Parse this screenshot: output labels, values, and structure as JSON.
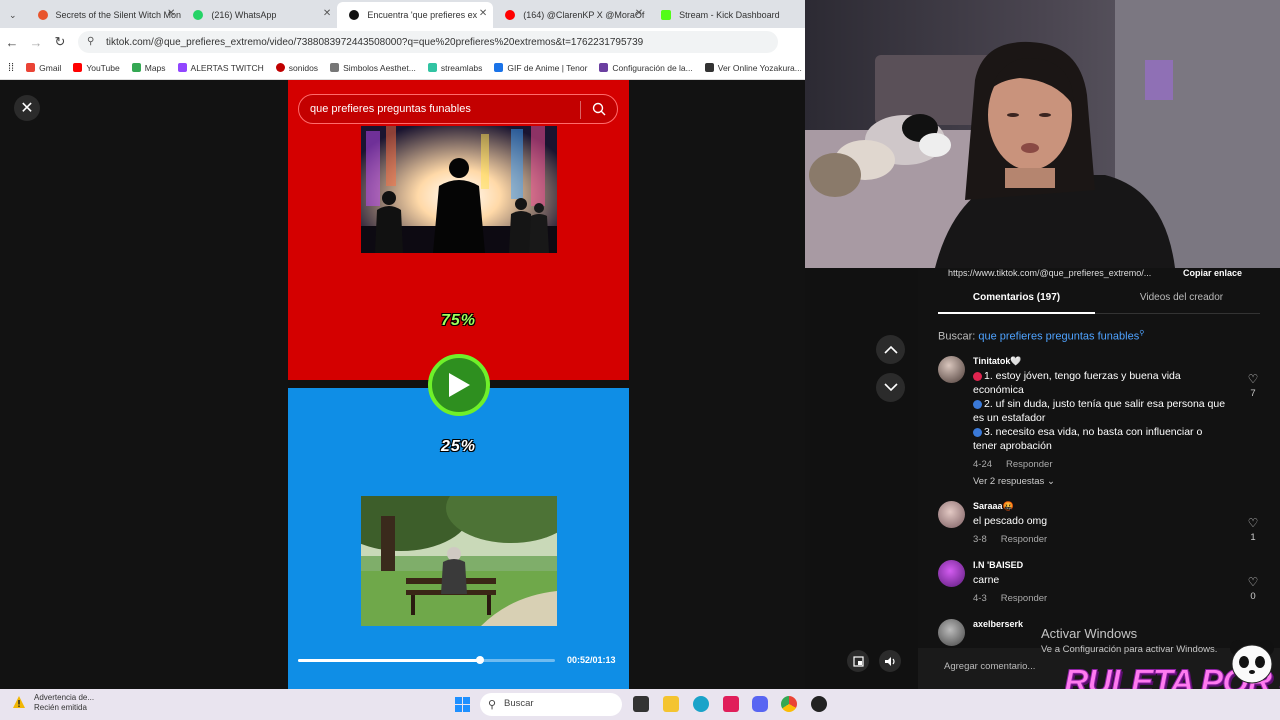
{
  "browser": {
    "tabs": [
      {
        "label": "Secrets of the Silent Witch Mon",
        "color": "#e8542c"
      },
      {
        "label": "(216) WhatsApp",
        "color": "#25d366"
      },
      {
        "label": "Encuentra 'que prefieres ex",
        "color": "#111111"
      },
      {
        "label": "(164) @ClarenKP X @MoraOf",
        "color": "#ff0000"
      },
      {
        "label": "Stream - Kick Dashboard",
        "color": "#53fc18"
      }
    ],
    "url": "tiktok.com/@que_prefieres_extremo/video/7388083972443508000?q=que%20prefieres%20extremos&t=1762231795739",
    "bookmarks": [
      {
        "label": "Gmail",
        "color": "#ea4335"
      },
      {
        "label": "YouTube",
        "color": "#ff0000"
      },
      {
        "label": "Maps",
        "color": "#34a853"
      },
      {
        "label": "ALERTAS TWITCH",
        "color": "#9146ff"
      },
      {
        "label": "sonidos",
        "color": "#c00000"
      },
      {
        "label": "Simbolos Aesthet...",
        "color": "#777777"
      },
      {
        "label": "streamlabs",
        "color": "#31c3a2"
      },
      {
        "label": "GIF de Anime | Tenor",
        "color": "#1a73e8"
      },
      {
        "label": "Configuración de la...",
        "color": "#6b3fa0"
      },
      {
        "label": "Ver Online Yozakura...",
        "color": "#333333"
      }
    ]
  },
  "video": {
    "search_text": "que prefieres preguntas funables",
    "top_percent": "75%",
    "bottom_percent": "25%",
    "progress": 0.71,
    "time": "00:52/01:13"
  },
  "panel": {
    "link_url": "https://www.tiktok.com/@que_prefieres_extremo/...",
    "copy_link": "Copiar enlace",
    "tab_comments": "Comentarios (197)",
    "tab_creator": "Videos del creador",
    "search_label": "Buscar:",
    "search_query": "que prefieres preguntas funables",
    "comments": [
      {
        "name": "Tinitatok🤍",
        "lines": [
          "1. estoy jóven, tengo fuerzas y buena vida económica",
          "2. uf sin duda, justo tenía que salir esa persona que es un estafador",
          "3. necesito esa vida, no basta con influenciar o tener aprobación"
        ],
        "date": "4-24",
        "reply": "Responder",
        "likes": "7",
        "more": "Ver 2 respuestas"
      },
      {
        "name": "Saraaa🤬",
        "text": "el pescado omg",
        "date": "3-8",
        "reply": "Responder",
        "likes": "1"
      },
      {
        "name": "I.N 'BAISED",
        "text": "carne",
        "date": "4-3",
        "reply": "Responder",
        "likes": "0"
      },
      {
        "name": "axelberserk"
      }
    ],
    "add_comment": "Agregar comentario..."
  },
  "overlay": {
    "activate_title": "Activar Windows",
    "activate_sub": "Ve a Configuración para activar Windows.",
    "ruleta": "RULETA POR SUB"
  },
  "taskbar": {
    "notif_title": "Advertencia de...",
    "notif_sub": "Recién emitida",
    "search_placeholder": "Buscar"
  }
}
